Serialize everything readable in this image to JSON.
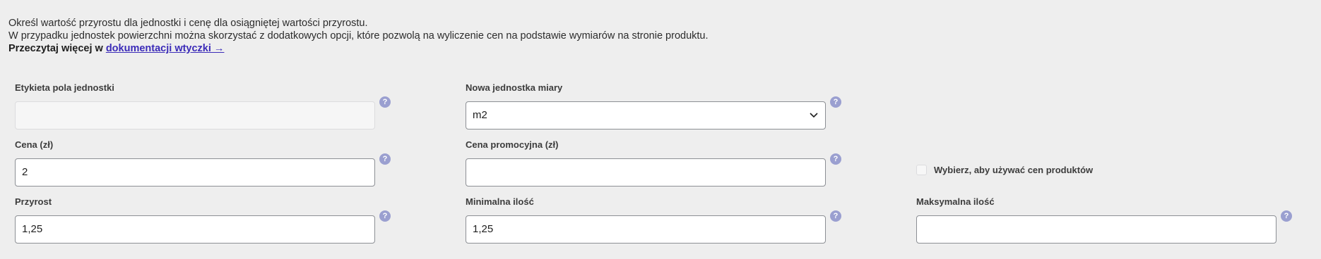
{
  "intro": {
    "line1": "Określ wartość przyrostu dla jednostki i cenę dla osiągniętej wartości przyrostu.",
    "line2": "W przypadku jednostek powierzchni można skorzystać z dodatkowych opcji, które pozwolą na wyliczenie cen na podstawie wymiarów na stronie produktu.",
    "line3_prefix": "Przeczytaj więcej w",
    "line3_link": "dokumentacji wtyczki →"
  },
  "fields": {
    "unit_label": {
      "label": "Etykieta pola jednostki",
      "value": ""
    },
    "new_unit": {
      "label": "Nowa jednostka miary",
      "value": "m2"
    },
    "price": {
      "label": "Cena (zł)",
      "value": "2"
    },
    "sale_price": {
      "label": "Cena promocyjna (zł)",
      "value": ""
    },
    "use_product_prices": {
      "label": "Wybierz, aby używać cen produktów",
      "checked": false
    },
    "increment": {
      "label": "Przyrost",
      "value": "1,25"
    },
    "min_qty": {
      "label": "Minimalna ilość",
      "value": "1,25"
    },
    "max_qty": {
      "label": "Maksymalna ilość",
      "value": ""
    }
  },
  "help_icon": "?",
  "icons": {
    "help": "question-circle-icon",
    "select": "chevron-down-icon"
  },
  "colors": {
    "background": "#eeeeee",
    "link": "#3b2bb8",
    "help_icon": "#9a9fd0",
    "input_border": "#8c8f94"
  }
}
